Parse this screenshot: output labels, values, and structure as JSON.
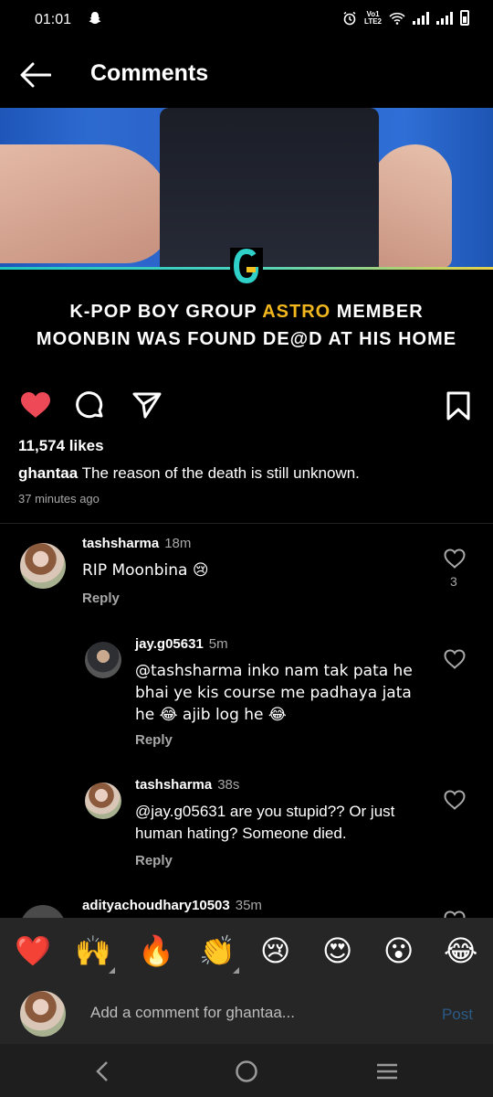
{
  "status_bar": {
    "time": "01:01",
    "network_top": "Vo1",
    "network_bottom": "LTE2"
  },
  "header": {
    "title": "Comments"
  },
  "post": {
    "headline_line1_pre": "K-POP BOY GROUP ",
    "headline_line1_highlight": "ASTRO",
    "headline_line1_post": " MEMBER",
    "headline_line2": "MOONBIN WAS FOUND DE@D AT HIS HOME",
    "likes": "11,574 likes",
    "caption_user": "ghantaa",
    "caption_text": " The reason of the death is still unknown.",
    "time_ago": "37 minutes ago"
  },
  "comments": [
    {
      "user": "tashsharma",
      "time": "18m",
      "text": "RIP Moonbina 😢",
      "reply": "Reply",
      "likes": "3"
    },
    {
      "user": "jay.g05631",
      "time": "5m",
      "text_line1": "@tashsharma inko nam tak pata he",
      "text_line2": "bhai ye kis course me padhaya jata",
      "text_line3": "he 😂 ajib log he 😂",
      "reply": "Reply"
    },
    {
      "user": "tashsharma",
      "time": "38s",
      "text_line1": "@jay.g05631 are you stupid?? Or just",
      "text_line2": "human hating? Someone died.",
      "reply": "Reply"
    },
    {
      "user": "adityachoudhary10503",
      "time": "35m"
    }
  ],
  "emoji_reactions": [
    "❤️",
    "🙌",
    "🔥",
    "👏",
    "😢",
    "😍",
    "😮",
    "😂"
  ],
  "composer": {
    "placeholder": "Add a comment for ghantaa...",
    "post_label": "Post"
  },
  "colors": {
    "like_red": "#ed4956",
    "headline_highlight": "#f2b61f",
    "post_button": "#2a5a86"
  }
}
